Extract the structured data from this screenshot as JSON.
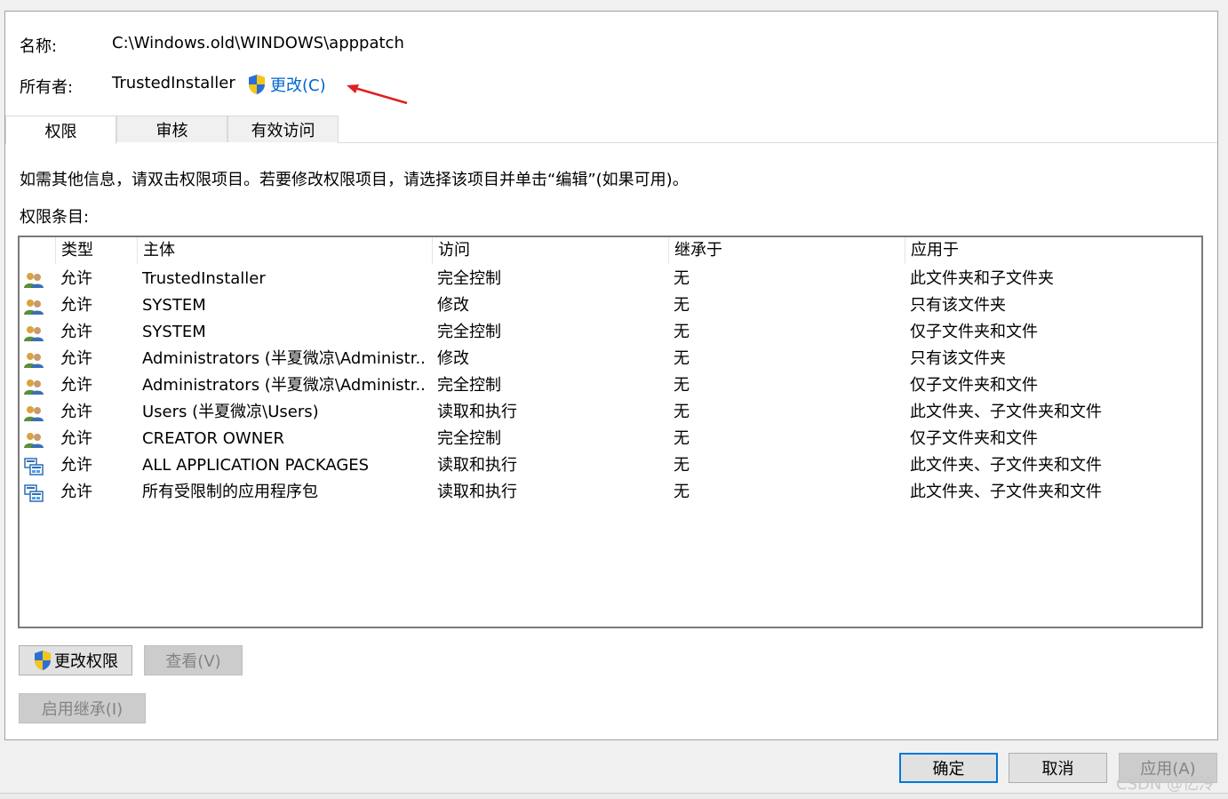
{
  "fields": {
    "name_label": "名称:",
    "name_value": "C:\\Windows.old\\WINDOWS\\apppatch",
    "owner_label": "所有者:",
    "owner_value": "TrustedInstaller",
    "change_label": "更改(C)"
  },
  "tabs": [
    {
      "label": "权限",
      "active": true
    },
    {
      "label": "审核",
      "active": false
    },
    {
      "label": "有效访问",
      "active": false
    }
  ],
  "info_text": "如需其他信息，请双击权限项目。若要修改权限项目，请选择该项目并单击“编辑”(如果可用)。",
  "entries_label": "权限条目:",
  "table": {
    "columns": [
      "类型",
      "主体",
      "访问",
      "继承于",
      "应用于"
    ],
    "rows": [
      {
        "icon": "user-group-icon",
        "type": "允许",
        "principal": "TrustedInstaller",
        "access": "完全控制",
        "inherited": "无",
        "applies": "此文件夹和子文件夹"
      },
      {
        "icon": "user-group-icon",
        "type": "允许",
        "principal": "SYSTEM",
        "access": "修改",
        "inherited": "无",
        "applies": "只有该文件夹"
      },
      {
        "icon": "user-group-icon",
        "type": "允许",
        "principal": "SYSTEM",
        "access": "完全控制",
        "inherited": "无",
        "applies": "仅子文件夹和文件"
      },
      {
        "icon": "user-group-icon",
        "type": "允许",
        "principal": "Administrators (半夏微凉\\Administr...",
        "access": "修改",
        "inherited": "无",
        "applies": "只有该文件夹"
      },
      {
        "icon": "user-group-icon",
        "type": "允许",
        "principal": "Administrators (半夏微凉\\Administr...",
        "access": "完全控制",
        "inherited": "无",
        "applies": "仅子文件夹和文件"
      },
      {
        "icon": "user-group-icon",
        "type": "允许",
        "principal": "Users (半夏微凉\\Users)",
        "access": "读取和执行",
        "inherited": "无",
        "applies": "此文件夹、子文件夹和文件"
      },
      {
        "icon": "user-group-icon",
        "type": "允许",
        "principal": "CREATOR OWNER",
        "access": "完全控制",
        "inherited": "无",
        "applies": "仅子文件夹和文件"
      },
      {
        "icon": "app-package-icon",
        "type": "允许",
        "principal": "ALL APPLICATION PACKAGES",
        "access": "读取和执行",
        "inherited": "无",
        "applies": "此文件夹、子文件夹和文件"
      },
      {
        "icon": "app-package-icon",
        "type": "允许",
        "principal": "所有受限制的应用程序包",
        "access": "读取和执行",
        "inherited": "无",
        "applies": "此文件夹、子文件夹和文件"
      }
    ]
  },
  "buttons": {
    "change_permissions": "更改权限",
    "view": "查看(V)",
    "enable_inheritance": "启用继承(I)",
    "ok": "确定",
    "cancel": "取消",
    "apply": "应用(A)"
  },
  "watermark": "CSDN @忆泠",
  "colors": {
    "link": "#0066cc",
    "arrow": "#e02020",
    "focus": "#0078d7"
  }
}
